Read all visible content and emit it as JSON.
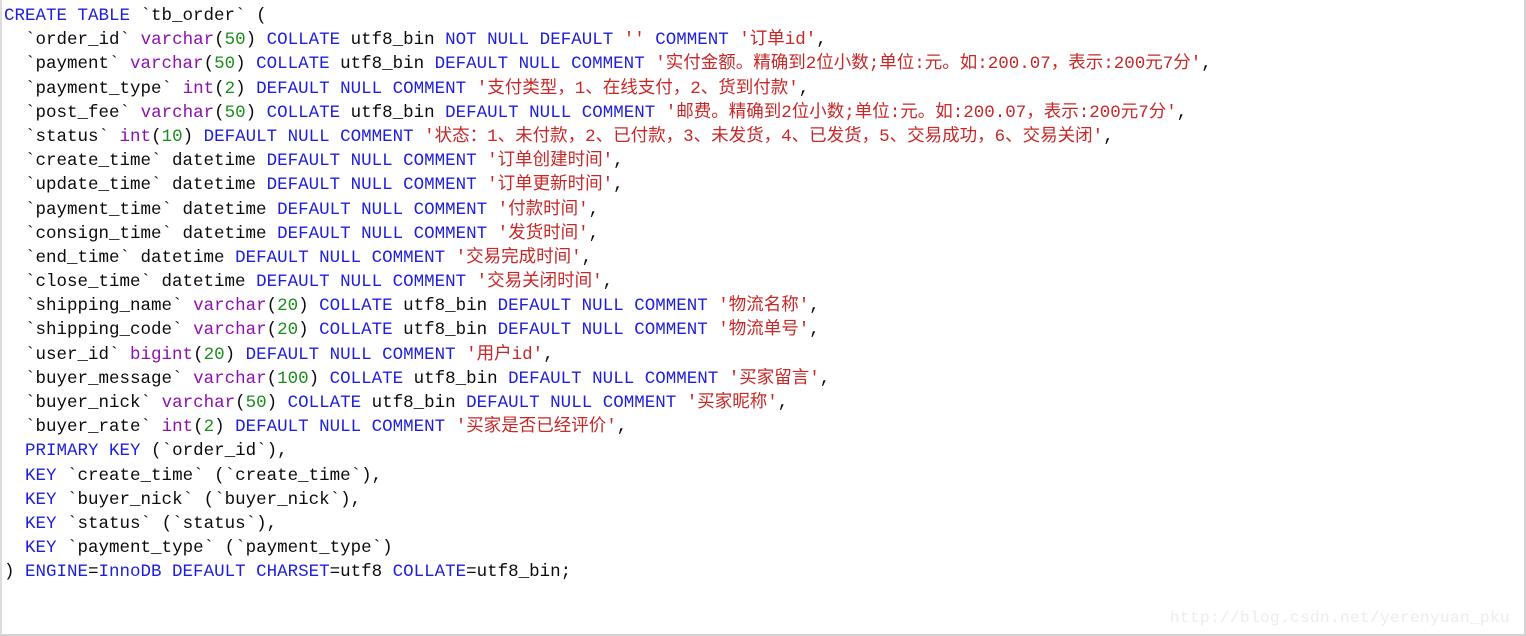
{
  "viewer": {
    "language": "sql",
    "watermark": "http://blog.csdn.net/yerenyuan_pku",
    "colors": {
      "background": "#ffffff",
      "keyword": "#1f1fdb",
      "datatype": "#8f10b0",
      "number": "#1a8c1a",
      "string": "#c62828",
      "plain": "#0b0b0b",
      "watermark": "#ececec",
      "border": "#d2d2d2"
    }
  },
  "code": {
    "full_text": "CREATE TABLE `tb_order` (\n  `order_id` varchar(50) COLLATE utf8_bin NOT NULL DEFAULT '' COMMENT '订单id',\n  `payment` varchar(50) COLLATE utf8_bin DEFAULT NULL COMMENT '实付金额。精确到2位小数;单位:元。如:200.07，表示:200元7分',\n  `payment_type` int(2) DEFAULT NULL COMMENT '支付类型，1、在线支付，2、货到付款',\n  `post_fee` varchar(50) COLLATE utf8_bin DEFAULT NULL COMMENT '邮费。精确到2位小数;单位:元。如:200.07，表示:200元7分',\n  `status` int(10) DEFAULT NULL COMMENT '状态：1、未付款，2、已付款，3、未发货，4、已发货，5、交易成功，6、交易关闭',\n  `create_time` datetime DEFAULT NULL COMMENT '订单创建时间',\n  `update_time` datetime DEFAULT NULL COMMENT '订单更新时间',\n  `payment_time` datetime DEFAULT NULL COMMENT '付款时间',\n  `consign_time` datetime DEFAULT NULL COMMENT '发货时间',\n  `end_time` datetime DEFAULT NULL COMMENT '交易完成时间',\n  `close_time` datetime DEFAULT NULL COMMENT '交易关闭时间',\n  `shipping_name` varchar(20) COLLATE utf8_bin DEFAULT NULL COMMENT '物流名称',\n  `shipping_code` varchar(20) COLLATE utf8_bin DEFAULT NULL COMMENT '物流单号',\n  `user_id` bigint(20) DEFAULT NULL COMMENT '用户id',\n  `buyer_message` varchar(100) COLLATE utf8_bin DEFAULT NULL COMMENT '买家留言',\n  `buyer_nick` varchar(50) COLLATE utf8_bin DEFAULT NULL COMMENT '买家昵称',\n  `buyer_rate` int(2) DEFAULT NULL COMMENT '买家是否已经评价',\n  PRIMARY KEY (`order_id`),\n  KEY `create_time` (`create_time`),\n  KEY `buyer_nick` (`buyer_nick`),\n  KEY `status` (`status`),\n  KEY `payment_type` (`payment_type`)\n) ENGINE=InnoDB DEFAULT CHARSET=utf8 COLLATE=utf8_bin;",
    "lines": [
      [
        {
          "t": "kw",
          "s": "CREATE TABLE"
        },
        {
          "t": "plain",
          "s": " "
        },
        {
          "t": "ident",
          "s": "`tb_order`"
        },
        {
          "t": "plain",
          "s": " ("
        }
      ],
      [
        {
          "t": "plain",
          "s": "  "
        },
        {
          "t": "ident",
          "s": "`order_id`"
        },
        {
          "t": "plain",
          "s": " "
        },
        {
          "t": "type",
          "s": "varchar"
        },
        {
          "t": "plain",
          "s": "("
        },
        {
          "t": "num",
          "s": "50"
        },
        {
          "t": "plain",
          "s": ") "
        },
        {
          "t": "kw",
          "s": "COLLATE"
        },
        {
          "t": "plain",
          "s": " utf8_bin "
        },
        {
          "t": "kw",
          "s": "NOT NULL DEFAULT"
        },
        {
          "t": "plain",
          "s": " "
        },
        {
          "t": "str",
          "s": "''"
        },
        {
          "t": "plain",
          "s": " "
        },
        {
          "t": "kw",
          "s": "COMMENT"
        },
        {
          "t": "plain",
          "s": " "
        },
        {
          "t": "str",
          "s": "'订单id'"
        },
        {
          "t": "plain",
          "s": ","
        }
      ],
      [
        {
          "t": "plain",
          "s": "  "
        },
        {
          "t": "ident",
          "s": "`payment`"
        },
        {
          "t": "plain",
          "s": " "
        },
        {
          "t": "type",
          "s": "varchar"
        },
        {
          "t": "plain",
          "s": "("
        },
        {
          "t": "num",
          "s": "50"
        },
        {
          "t": "plain",
          "s": ") "
        },
        {
          "t": "kw",
          "s": "COLLATE"
        },
        {
          "t": "plain",
          "s": " utf8_bin "
        },
        {
          "t": "kw",
          "s": "DEFAULT NULL COMMENT"
        },
        {
          "t": "plain",
          "s": " "
        },
        {
          "t": "str",
          "s": "'实付金额。精确到2位小数;单位:元。如:200.07，表示:200元7分'"
        },
        {
          "t": "plain",
          "s": ","
        }
      ],
      [
        {
          "t": "plain",
          "s": "  "
        },
        {
          "t": "ident",
          "s": "`payment_type`"
        },
        {
          "t": "plain",
          "s": " "
        },
        {
          "t": "type",
          "s": "int"
        },
        {
          "t": "plain",
          "s": "("
        },
        {
          "t": "num",
          "s": "2"
        },
        {
          "t": "plain",
          "s": ") "
        },
        {
          "t": "kw",
          "s": "DEFAULT NULL COMMENT"
        },
        {
          "t": "plain",
          "s": " "
        },
        {
          "t": "str",
          "s": "'支付类型，1、在线支付，2、货到付款'"
        },
        {
          "t": "plain",
          "s": ","
        }
      ],
      [
        {
          "t": "plain",
          "s": "  "
        },
        {
          "t": "ident",
          "s": "`post_fee`"
        },
        {
          "t": "plain",
          "s": " "
        },
        {
          "t": "type",
          "s": "varchar"
        },
        {
          "t": "plain",
          "s": "("
        },
        {
          "t": "num",
          "s": "50"
        },
        {
          "t": "plain",
          "s": ") "
        },
        {
          "t": "kw",
          "s": "COLLATE"
        },
        {
          "t": "plain",
          "s": " utf8_bin "
        },
        {
          "t": "kw",
          "s": "DEFAULT NULL COMMENT"
        },
        {
          "t": "plain",
          "s": " "
        },
        {
          "t": "str",
          "s": "'邮费。精确到2位小数;单位:元。如:200.07，表示:200元7分'"
        },
        {
          "t": "plain",
          "s": ","
        }
      ],
      [
        {
          "t": "plain",
          "s": "  "
        },
        {
          "t": "ident",
          "s": "`status`"
        },
        {
          "t": "plain",
          "s": " "
        },
        {
          "t": "type",
          "s": "int"
        },
        {
          "t": "plain",
          "s": "("
        },
        {
          "t": "num",
          "s": "10"
        },
        {
          "t": "plain",
          "s": ") "
        },
        {
          "t": "kw",
          "s": "DEFAULT NULL COMMENT"
        },
        {
          "t": "plain",
          "s": " "
        },
        {
          "t": "str",
          "s": "'状态：1、未付款，2、已付款，3、未发货，4、已发货，5、交易成功，6、交易关闭'"
        },
        {
          "t": "plain",
          "s": ","
        }
      ],
      [
        {
          "t": "plain",
          "s": "  "
        },
        {
          "t": "ident",
          "s": "`create_time`"
        },
        {
          "t": "plain",
          "s": " datetime "
        },
        {
          "t": "kw",
          "s": "DEFAULT NULL COMMENT"
        },
        {
          "t": "plain",
          "s": " "
        },
        {
          "t": "str",
          "s": "'订单创建时间'"
        },
        {
          "t": "plain",
          "s": ","
        }
      ],
      [
        {
          "t": "plain",
          "s": "  "
        },
        {
          "t": "ident",
          "s": "`update_time`"
        },
        {
          "t": "plain",
          "s": " datetime "
        },
        {
          "t": "kw",
          "s": "DEFAULT NULL COMMENT"
        },
        {
          "t": "plain",
          "s": " "
        },
        {
          "t": "str",
          "s": "'订单更新时间'"
        },
        {
          "t": "plain",
          "s": ","
        }
      ],
      [
        {
          "t": "plain",
          "s": "  "
        },
        {
          "t": "ident",
          "s": "`payment_time`"
        },
        {
          "t": "plain",
          "s": " datetime "
        },
        {
          "t": "kw",
          "s": "DEFAULT NULL COMMENT"
        },
        {
          "t": "plain",
          "s": " "
        },
        {
          "t": "str",
          "s": "'付款时间'"
        },
        {
          "t": "plain",
          "s": ","
        }
      ],
      [
        {
          "t": "plain",
          "s": "  "
        },
        {
          "t": "ident",
          "s": "`consign_time`"
        },
        {
          "t": "plain",
          "s": " datetime "
        },
        {
          "t": "kw",
          "s": "DEFAULT NULL COMMENT"
        },
        {
          "t": "plain",
          "s": " "
        },
        {
          "t": "str",
          "s": "'发货时间'"
        },
        {
          "t": "plain",
          "s": ","
        }
      ],
      [
        {
          "t": "plain",
          "s": "  "
        },
        {
          "t": "ident",
          "s": "`end_time`"
        },
        {
          "t": "plain",
          "s": " datetime "
        },
        {
          "t": "kw",
          "s": "DEFAULT NULL COMMENT"
        },
        {
          "t": "plain",
          "s": " "
        },
        {
          "t": "str",
          "s": "'交易完成时间'"
        },
        {
          "t": "plain",
          "s": ","
        }
      ],
      [
        {
          "t": "plain",
          "s": "  "
        },
        {
          "t": "ident",
          "s": "`close_time`"
        },
        {
          "t": "plain",
          "s": " datetime "
        },
        {
          "t": "kw",
          "s": "DEFAULT NULL COMMENT"
        },
        {
          "t": "plain",
          "s": " "
        },
        {
          "t": "str",
          "s": "'交易关闭时间'"
        },
        {
          "t": "plain",
          "s": ","
        }
      ],
      [
        {
          "t": "plain",
          "s": "  "
        },
        {
          "t": "ident",
          "s": "`shipping_name`"
        },
        {
          "t": "plain",
          "s": " "
        },
        {
          "t": "type",
          "s": "varchar"
        },
        {
          "t": "plain",
          "s": "("
        },
        {
          "t": "num",
          "s": "20"
        },
        {
          "t": "plain",
          "s": ") "
        },
        {
          "t": "kw",
          "s": "COLLATE"
        },
        {
          "t": "plain",
          "s": " utf8_bin "
        },
        {
          "t": "kw",
          "s": "DEFAULT NULL COMMENT"
        },
        {
          "t": "plain",
          "s": " "
        },
        {
          "t": "str",
          "s": "'物流名称'"
        },
        {
          "t": "plain",
          "s": ","
        }
      ],
      [
        {
          "t": "plain",
          "s": "  "
        },
        {
          "t": "ident",
          "s": "`shipping_code`"
        },
        {
          "t": "plain",
          "s": " "
        },
        {
          "t": "type",
          "s": "varchar"
        },
        {
          "t": "plain",
          "s": "("
        },
        {
          "t": "num",
          "s": "20"
        },
        {
          "t": "plain",
          "s": ") "
        },
        {
          "t": "kw",
          "s": "COLLATE"
        },
        {
          "t": "plain",
          "s": " utf8_bin "
        },
        {
          "t": "kw",
          "s": "DEFAULT NULL COMMENT"
        },
        {
          "t": "plain",
          "s": " "
        },
        {
          "t": "str",
          "s": "'物流单号'"
        },
        {
          "t": "plain",
          "s": ","
        }
      ],
      [
        {
          "t": "plain",
          "s": "  "
        },
        {
          "t": "ident",
          "s": "`user_id`"
        },
        {
          "t": "plain",
          "s": " "
        },
        {
          "t": "type",
          "s": "bigint"
        },
        {
          "t": "plain",
          "s": "("
        },
        {
          "t": "num",
          "s": "20"
        },
        {
          "t": "plain",
          "s": ") "
        },
        {
          "t": "kw",
          "s": "DEFAULT NULL COMMENT"
        },
        {
          "t": "plain",
          "s": " "
        },
        {
          "t": "str",
          "s": "'用户id'"
        },
        {
          "t": "plain",
          "s": ","
        }
      ],
      [
        {
          "t": "plain",
          "s": "  "
        },
        {
          "t": "ident",
          "s": "`buyer_message`"
        },
        {
          "t": "plain",
          "s": " "
        },
        {
          "t": "type",
          "s": "varchar"
        },
        {
          "t": "plain",
          "s": "("
        },
        {
          "t": "num",
          "s": "100"
        },
        {
          "t": "plain",
          "s": ") "
        },
        {
          "t": "kw",
          "s": "COLLATE"
        },
        {
          "t": "plain",
          "s": " utf8_bin "
        },
        {
          "t": "kw",
          "s": "DEFAULT NULL COMMENT"
        },
        {
          "t": "plain",
          "s": " "
        },
        {
          "t": "str",
          "s": "'买家留言'"
        },
        {
          "t": "plain",
          "s": ","
        }
      ],
      [
        {
          "t": "plain",
          "s": "  "
        },
        {
          "t": "ident",
          "s": "`buyer_nick`"
        },
        {
          "t": "plain",
          "s": " "
        },
        {
          "t": "type",
          "s": "varchar"
        },
        {
          "t": "plain",
          "s": "("
        },
        {
          "t": "num",
          "s": "50"
        },
        {
          "t": "plain",
          "s": ") "
        },
        {
          "t": "kw",
          "s": "COLLATE"
        },
        {
          "t": "plain",
          "s": " utf8_bin "
        },
        {
          "t": "kw",
          "s": "DEFAULT NULL COMMENT"
        },
        {
          "t": "plain",
          "s": " "
        },
        {
          "t": "str",
          "s": "'买家昵称'"
        },
        {
          "t": "plain",
          "s": ","
        }
      ],
      [
        {
          "t": "plain",
          "s": "  "
        },
        {
          "t": "ident",
          "s": "`buyer_rate`"
        },
        {
          "t": "plain",
          "s": " "
        },
        {
          "t": "type",
          "s": "int"
        },
        {
          "t": "plain",
          "s": "("
        },
        {
          "t": "num",
          "s": "2"
        },
        {
          "t": "plain",
          "s": ") "
        },
        {
          "t": "kw",
          "s": "DEFAULT NULL COMMENT"
        },
        {
          "t": "plain",
          "s": " "
        },
        {
          "t": "str",
          "s": "'买家是否已经评价'"
        },
        {
          "t": "plain",
          "s": ","
        }
      ],
      [
        {
          "t": "plain",
          "s": "  "
        },
        {
          "t": "kw",
          "s": "PRIMARY KEY"
        },
        {
          "t": "plain",
          "s": " ("
        },
        {
          "t": "ident",
          "s": "`order_id`"
        },
        {
          "t": "plain",
          "s": "),"
        }
      ],
      [
        {
          "t": "plain",
          "s": "  "
        },
        {
          "t": "kw",
          "s": "KEY"
        },
        {
          "t": "plain",
          "s": " "
        },
        {
          "t": "ident",
          "s": "`create_time`"
        },
        {
          "t": "plain",
          "s": " ("
        },
        {
          "t": "ident",
          "s": "`create_time`"
        },
        {
          "t": "plain",
          "s": "),"
        }
      ],
      [
        {
          "t": "plain",
          "s": "  "
        },
        {
          "t": "kw",
          "s": "KEY"
        },
        {
          "t": "plain",
          "s": " "
        },
        {
          "t": "ident",
          "s": "`buyer_nick`"
        },
        {
          "t": "plain",
          "s": " ("
        },
        {
          "t": "ident",
          "s": "`buyer_nick`"
        },
        {
          "t": "plain",
          "s": "),"
        }
      ],
      [
        {
          "t": "plain",
          "s": "  "
        },
        {
          "t": "kw",
          "s": "KEY"
        },
        {
          "t": "plain",
          "s": " "
        },
        {
          "t": "ident",
          "s": "`status`"
        },
        {
          "t": "plain",
          "s": " ("
        },
        {
          "t": "ident",
          "s": "`status`"
        },
        {
          "t": "plain",
          "s": "),"
        }
      ],
      [
        {
          "t": "plain",
          "s": "  "
        },
        {
          "t": "kw",
          "s": "KEY"
        },
        {
          "t": "plain",
          "s": " "
        },
        {
          "t": "ident",
          "s": "`payment_type`"
        },
        {
          "t": "plain",
          "s": " ("
        },
        {
          "t": "ident",
          "s": "`payment_type`"
        },
        {
          "t": "plain",
          "s": ")"
        }
      ],
      [
        {
          "t": "plain",
          "s": ") "
        },
        {
          "t": "kw",
          "s": "ENGINE"
        },
        {
          "t": "plain",
          "s": "="
        },
        {
          "t": "kw",
          "s": "InnoDB DEFAULT CHARSET"
        },
        {
          "t": "plain",
          "s": "=utf8 "
        },
        {
          "t": "kw",
          "s": "COLLATE"
        },
        {
          "t": "plain",
          "s": "=utf8_bin;"
        }
      ]
    ]
  }
}
